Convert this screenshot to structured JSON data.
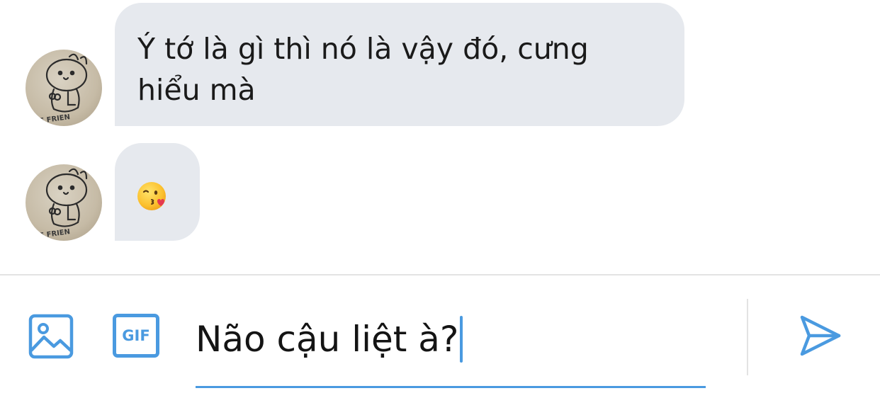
{
  "colors": {
    "accent": "#4a9ae0",
    "bubble_bg": "#e6e9ee",
    "divider": "#e3e3e3",
    "text": "#141414"
  },
  "messages": [
    {
      "sender": "received",
      "text": "Ý tớ là gì thì nó là vậy đó, cưng hiểu mà",
      "avatar_icon": "bear-avatar-icon"
    },
    {
      "sender": "received",
      "text": "",
      "emoji": "kissing-face-with-heart-emoji"
    }
  ],
  "composer": {
    "image_icon": "image-icon",
    "gif_label": "GIF",
    "input_value": "Não cậu liệt à?",
    "send_icon": "send-icon"
  }
}
